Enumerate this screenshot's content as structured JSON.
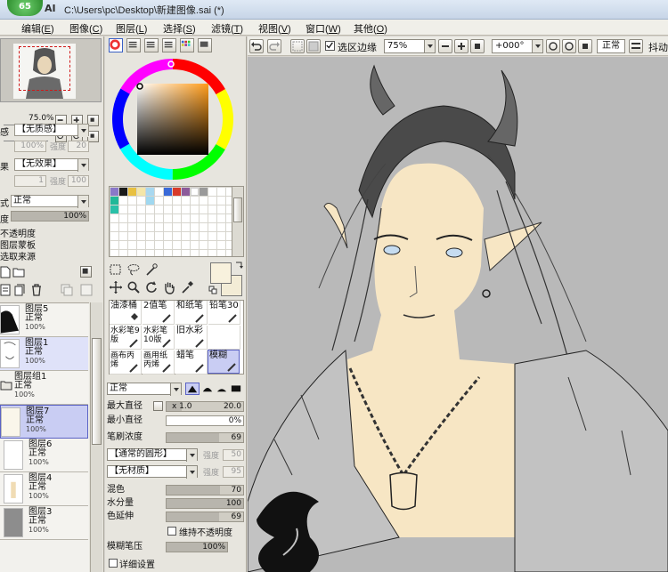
{
  "window": {
    "badge": "65",
    "title": "C:\\Users\\pc\\Desktop\\新建图像.sai (*)",
    "logo_fragment": "AI"
  },
  "menu": [
    {
      "label": "编辑",
      "key": "E"
    },
    {
      "label": "图像",
      "key": "C"
    },
    {
      "label": "图层",
      "key": "L"
    },
    {
      "label": "选择",
      "key": "S"
    },
    {
      "label": "滤镜",
      "key": "T"
    },
    {
      "label": "视图",
      "key": "V"
    },
    {
      "label": "窗口",
      "key": "W"
    },
    {
      "label": "其他",
      "key": "O"
    }
  ],
  "toolbar": {
    "selection_edge_label": "选区边缘",
    "selection_edge_checked": true,
    "zoom": "75%",
    "rotation": "+000°",
    "blend_mode": "正常",
    "stabilizer_label": "抖动"
  },
  "navigator": {
    "zoom": "75.0%",
    "rotation": "+000"
  },
  "layer_props": {
    "texture_prefix": "感",
    "texture_value": "【无质感】",
    "texture_percent": "100%",
    "texture_strength_label": "强度",
    "texture_strength": "20",
    "effect_prefix": "果",
    "effect_value": "【无效果】",
    "effect_width": "1",
    "effect_strength_label": "强度",
    "effect_strength": "100",
    "mode_prefix": "式",
    "mode_value": "正常",
    "opacity_prefix": "度",
    "opacity_value": "100%",
    "checks": [
      "不透明度",
      "图层蒙板",
      "选取来源"
    ]
  },
  "layers": [
    {
      "name": "图层5",
      "mode": "正常",
      "opacity": "100%"
    },
    {
      "name": "图层1",
      "mode": "正常",
      "opacity": "100%"
    },
    {
      "name": "图层组1",
      "mode": "正常",
      "opacity": "100%"
    },
    {
      "name": "图层7",
      "mode": "正常",
      "opacity": "100%"
    },
    {
      "name": "图层6",
      "mode": "正常",
      "opacity": "100%"
    },
    {
      "name": "图层4",
      "mode": "正常",
      "opacity": "100%"
    },
    {
      "name": "图层3",
      "mode": "正常",
      "opacity": "100%"
    }
  ],
  "palette_colors": [
    "#8a78c8",
    "#1a1a1a",
    "#e8c040",
    "#f4e6a8",
    "#a8d8f0",
    "#3a6ad8",
    "#d83a2a",
    "#8c5a9a",
    "#ffffff",
    "#9a9a9a",
    "#20b898",
    "#a0d8f0",
    "#2ac0a8"
  ],
  "colors": {
    "foreground": "#f8f1dd",
    "background": "#f3ecd6",
    "selection": "#c9cdf3",
    "canvas_bg": "#b9b9b9"
  },
  "brushes": [
    {
      "label": "油漆桶"
    },
    {
      "label": "2值笔"
    },
    {
      "label": "和纸笔"
    },
    {
      "label": "铅笔30"
    },
    {
      "label": "水彩笔9版"
    },
    {
      "label": "水彩笔10版"
    },
    {
      "label": "旧水彩"
    },
    {
      "label": ""
    },
    {
      "label": "画布丙烯"
    },
    {
      "label": "画用纸丙烯"
    },
    {
      "label": "蜡笔"
    },
    {
      "label": "模糊"
    }
  ],
  "brush_settings": {
    "mode": "正常",
    "max_size_label": "最大直径",
    "multiplier": "x 1.0",
    "max_size": "20.0",
    "min_size_label": "最小直径",
    "min_size": "0%",
    "density_label": "笔刷浓度",
    "density": "69",
    "shape_value": "【通常的圆形】",
    "shape_strength_label": "强度",
    "shape_strength": "50",
    "texture_value": "【无材质】",
    "texture_strength_label": "强度",
    "texture_strength": "95",
    "blend_label": "混色",
    "blend": "70",
    "water_label": "水分量",
    "water": "100",
    "persistence_label": "色延伸",
    "persistence": "69",
    "keep_opacity_label": "维持不透明度",
    "blur_pressure_label": "模糊笔压",
    "blur_pressure": "100%",
    "details_label": "详细设置"
  }
}
